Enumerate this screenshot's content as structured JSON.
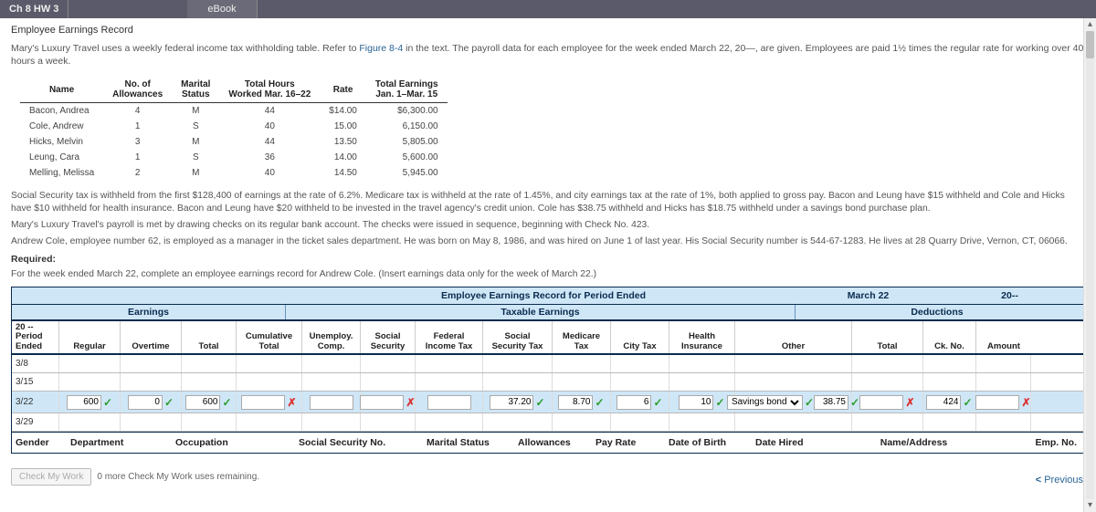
{
  "header": {
    "hw": "Ch 8 HW 3",
    "tab": "eBook"
  },
  "title": "Employee Earnings Record",
  "intro": "Mary's Luxury Travel uses a weekly federal income tax withholding table. Refer to ",
  "intro_link": "Figure 8-4",
  "intro2": " in the text. The payroll data for each employee for the week ended March 22, 20—, are given. Employees are paid 1½ times the regular rate for working over 40 hours a week.",
  "payroll": {
    "headers": {
      "name": "Name",
      "allow": "No. of\nAllowances",
      "marital": "Marital\nStatus",
      "hours": "Total Hours\nWorked Mar. 16–22",
      "rate": "Rate",
      "tot": "Total Earnings\nJan. 1–Mar. 15"
    },
    "rows": [
      {
        "name": "Bacon, Andrea",
        "allow": "4",
        "ms": "M",
        "hrs": "44",
        "rate": "$14.00",
        "tot": "$6,300.00"
      },
      {
        "name": "Cole, Andrew",
        "allow": "1",
        "ms": "S",
        "hrs": "40",
        "rate": "15.00",
        "tot": "6,150.00"
      },
      {
        "name": "Hicks, Melvin",
        "allow": "3",
        "ms": "M",
        "hrs": "44",
        "rate": "13.50",
        "tot": "5,805.00"
      },
      {
        "name": "Leung, Cara",
        "allow": "1",
        "ms": "S",
        "hrs": "36",
        "rate": "14.00",
        "tot": "5,600.00"
      },
      {
        "name": "Melling, Melissa",
        "allow": "2",
        "ms": "M",
        "hrs": "40",
        "rate": "14.50",
        "tot": "5,945.00"
      }
    ]
  },
  "para1": "Social Security tax is withheld from the first $128,400 of earnings at the rate of 6.2%. Medicare tax is withheld at the rate of 1.45%, and city earnings tax at the rate of 1%, both applied to gross pay. Bacon and Leung have $15 withheld and Cole and Hicks have $10 withheld for health insurance. Bacon and Leung have $20 withheld to be invested in the travel agency's credit union. Cole has $38.75 withheld and Hicks has $18.75 withheld under a savings bond purchase plan.",
  "para2": "Mary's Luxury Travel's payroll is met by drawing checks on its regular bank account. The checks were issued in sequence, beginning with Check No. 423.",
  "para3": "Andrew Cole, employee number 62, is employed as a manager in the ticket sales department. He was born on May 8, 1986, and was hired on June 1 of last year. His Social Security number is 544-67-1283. He lives at 28 Quarry Drive, Vernon, CT, 06066.",
  "required_lbl": "Required:",
  "required": "For the week ended March 22, complete an employee earnings record for Andrew Cole. (Insert earnings data only for the week of March 22.)",
  "record": {
    "title": "Employee Earnings Record for Period Ended",
    "date": "March 22",
    "year": "20--",
    "sec_earn": "Earnings",
    "sec_tax": "Taxable Earnings",
    "sec_ded": "Deductions",
    "cols": {
      "period": "20 --\nPeriod\nEnded",
      "reg": "Regular",
      "ot": "Overtime",
      "total": "Total",
      "cum": "Cumulative\nTotal",
      "unemp": "Unemploy.\nComp.",
      "ss": "Social\nSecurity",
      "fed": "Federal\nIncome Tax",
      "sstax": "Social\nSecurity Tax",
      "med": "Medicare\nTax",
      "city": "City Tax",
      "health": "Health\nInsurance",
      "other": "Other",
      "dedtot": "Total",
      "ck": "Ck. No.",
      "amt": "Amount"
    },
    "rows": [
      "3/8",
      "3/15",
      "3/22",
      "3/29"
    ],
    "values": {
      "reg": "600",
      "ot": "0",
      "total": "600",
      "sstax": "37.20",
      "med": "8.70",
      "city": "6",
      "health": "10",
      "other_sel": "Savings bond",
      "other_amt": "38.75",
      "ck": "424"
    },
    "footer": {
      "gender": "Gender",
      "dept": "Department",
      "occ": "Occupation",
      "ssn": "Social Security No.",
      "ms": "Marital Status",
      "allow": "Allowances",
      "rate": "Pay Rate",
      "dob": "Date of Birth",
      "hired": "Date Hired",
      "addr": "Name/Address",
      "emp": "Emp. No."
    }
  },
  "check": {
    "btn": "Check My Work",
    "text": "0 more Check My Work uses remaining."
  },
  "prev": "Previous"
}
